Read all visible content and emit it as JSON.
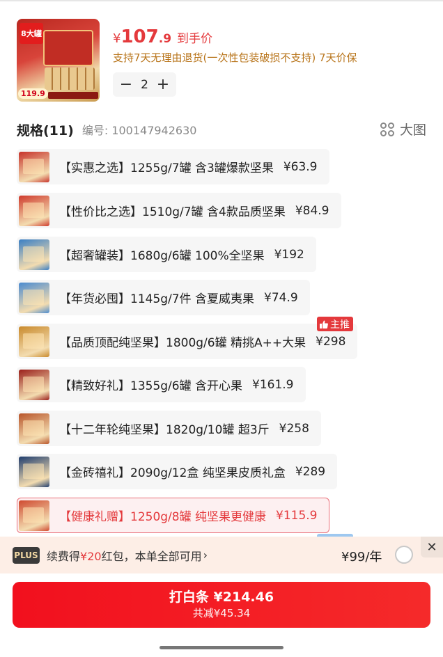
{
  "product": {
    "thumb_badge": "8大罐",
    "thumb_price": "119.9",
    "price_yen": "¥",
    "price_int": "107",
    "price_dec": ".9",
    "price_label": "到手价",
    "service_text": "支持7天无理由退货(一次性包装破损不支持)  7天价保",
    "quantity": "2",
    "minus_symbol": "−",
    "plus_symbol": "+"
  },
  "spec": {
    "title": "规格(11)",
    "code": "编号: 100147942630",
    "big_view_label": "大图"
  },
  "spec_items": [
    {
      "name": "【实惠之选】1255g/7罐 含3罐爆款坚果",
      "price": "¥63.9",
      "color": "#c7332b"
    },
    {
      "name": "【性价比之选】1510g/7罐 含4款品质坚果",
      "price": "¥84.9",
      "color": "#cf3a2c"
    },
    {
      "name": "【超奢罐装】1680g/6罐 100%全坚果",
      "price": "¥192",
      "color": "#3a7fc4"
    },
    {
      "name": "【年货必囤】1145g/7件 含夏威夷果",
      "price": "¥74.9",
      "color": "#4b8bd0"
    },
    {
      "name": "【品质顶配纯坚果】1800g/6罐 精挑A++大果",
      "price": "¥298",
      "color": "#c98a2c"
    },
    {
      "name": "【精致好礼】1355g/6罐 含开心果",
      "price": "¥161.9",
      "color": "#9a1f1a"
    },
    {
      "name": "【十二年轮纯坚果】1820g/10罐 超3斤",
      "price": "¥258",
      "color": "#b8552a"
    },
    {
      "name": "【金砖禧礼】2090g/12盒  纯坚果皮质礼盒",
      "price": "¥289",
      "color": "#1f3d6e"
    },
    {
      "name": "【健康礼赠】1250g/8罐 纯坚果更健康",
      "price": "¥115.9",
      "color": "#cf4a30"
    }
  ],
  "recommend_badge": "主推",
  "plus": {
    "logo": "PLUS",
    "text_before": "续费得",
    "text_highlight": "¥20",
    "text_after": "红包，本单全部可用",
    "chevron": "›",
    "fee": "¥99/年",
    "close": "✕"
  },
  "checkout": {
    "main": "打白条 ¥214.46",
    "sub": "共减¥45.34"
  },
  "colors": {
    "accent": "#e4393c",
    "service": "#b8741a"
  }
}
